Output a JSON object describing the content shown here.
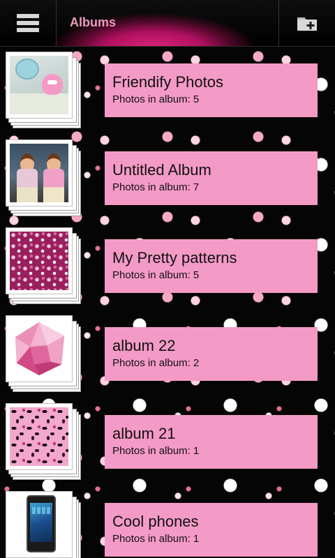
{
  "header": {
    "title": "Albums",
    "menu_icon": "menu-icon",
    "add_album_icon": "add-folder-icon",
    "accent_color": "#f29ac0"
  },
  "albums": [
    {
      "name": "Friendify Photos",
      "count_label": "Photos in album: 5",
      "thumbnail": "toy-on-table-photo"
    },
    {
      "name": "Untitled Album",
      "count_label": "Photos in album: 7",
      "thumbnail": "two-girls-photo"
    },
    {
      "name": "My Pretty patterns",
      "count_label": "Photos in album: 5",
      "thumbnail": "pink-floral-pattern"
    },
    {
      "name": "album 22",
      "count_label": "Photos in album: 2",
      "thumbnail": "pink-gem-graphic"
    },
    {
      "name": "album 21",
      "count_label": "Photos in album: 1",
      "thumbnail": "pink-leopard-pattern"
    },
    {
      "name": "Cool phones",
      "count_label": "Photos in album: 1",
      "thumbnail": "smartphone-photo"
    }
  ],
  "colors": {
    "card_background": "#f49ac6",
    "page_background": "#050505"
  }
}
